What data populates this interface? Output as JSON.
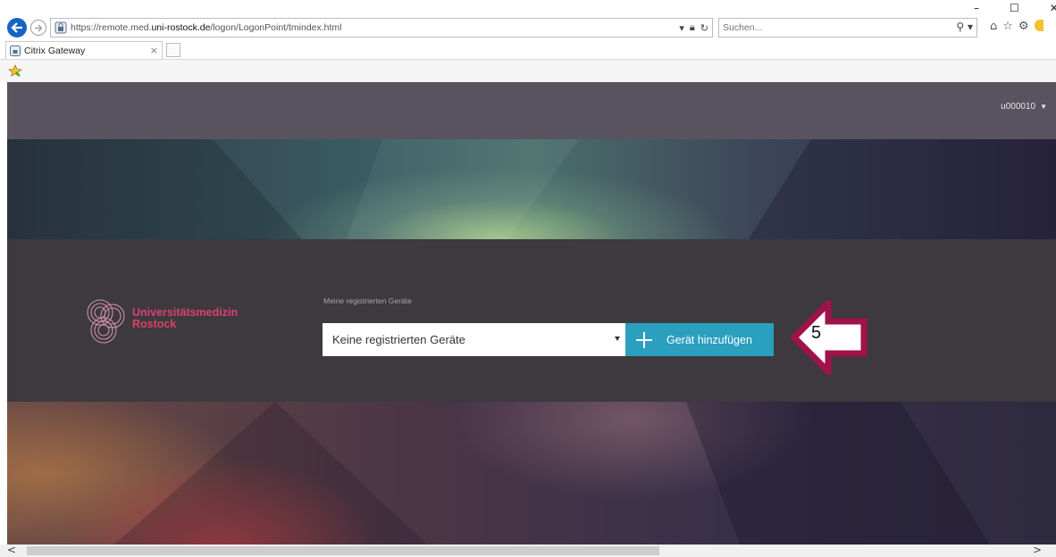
{
  "browser": {
    "url_prefix": "https://remote.med.",
    "url_domain": "uni-rostock.de",
    "url_path": "/logon/LogonPoint/tmindex.html",
    "search_placeholder": "Suchen...",
    "tab_title": "Citrix Gateway",
    "tab_close": "×",
    "window_controls": [
      "–",
      "☐",
      "✕"
    ],
    "icons": [
      "back-arrow-icon",
      "forward-arrow-icon",
      "lock-icon",
      "refresh-icon",
      "search-icon",
      "home-icon",
      "star-icon",
      "gear-icon",
      "favorites-star-icon"
    ]
  },
  "topbar": {
    "username": "u000010"
  },
  "logo": {
    "line1": "Universitätsmedizin",
    "line2": "Rostock"
  },
  "devices": {
    "label": "Meine registrierten Geräte",
    "select_value": "Keine registrierten Geräte",
    "add_button_label": "Gerät hinzufügen"
  },
  "annotation": {
    "step_number": "5",
    "arrow_color": "#a0124a"
  },
  "colors": {
    "accent_button": "#2a9fbe",
    "logo": "#d9426c",
    "topbar": "#595360"
  }
}
